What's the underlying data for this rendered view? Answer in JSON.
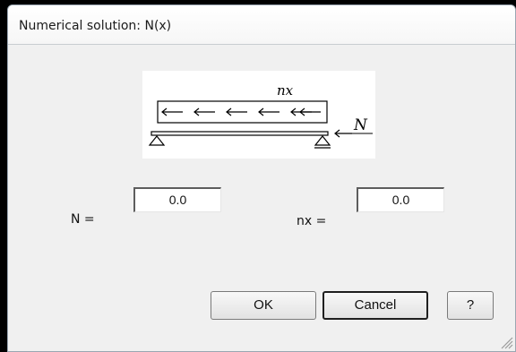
{
  "dialog": {
    "title": "Numerical solution: N(x)"
  },
  "diagram": {
    "load_label": "nx",
    "force_label": "N"
  },
  "fields": {
    "n_label": "N =",
    "n_value": "0.0",
    "nx_label": "nx =",
    "nx_value": "0.0"
  },
  "buttons": {
    "ok": "OK",
    "cancel": "Cancel",
    "help": "?"
  }
}
